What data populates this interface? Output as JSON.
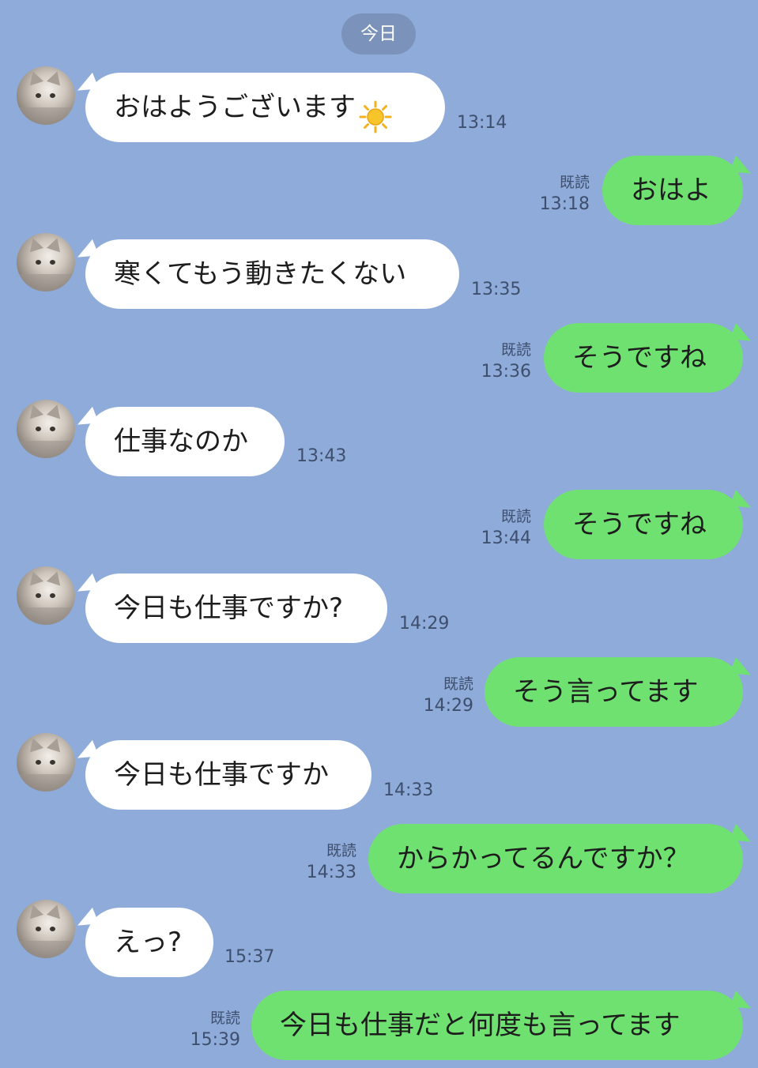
{
  "date_label": "今日",
  "read_label": "既読",
  "colors": {
    "background": "#8fabd9",
    "incoming_bubble": "#ffffff",
    "outgoing_bubble": "#6fe170",
    "date_pill": "#7b93bb"
  },
  "messages": [
    {
      "side": "in",
      "text": "おはようございます",
      "emoji": "sun-icon",
      "time": "13:14"
    },
    {
      "side": "out",
      "text": "おはよ",
      "read": "既読",
      "time": "13:18"
    },
    {
      "side": "in",
      "text": "寒くてもう動きたくない",
      "time": "13:35"
    },
    {
      "side": "out",
      "text": "そうですね",
      "read": "既読",
      "time": "13:36"
    },
    {
      "side": "in",
      "text": "仕事なのか",
      "time": "13:43"
    },
    {
      "side": "out",
      "text": "そうですね",
      "read": "既読",
      "time": "13:44"
    },
    {
      "side": "in",
      "text": "今日も仕事ですか?",
      "time": "14:29"
    },
    {
      "side": "out",
      "text": "そう言ってます",
      "read": "既読",
      "time": "14:29"
    },
    {
      "side": "in",
      "text": "今日も仕事ですか",
      "time": "14:33"
    },
    {
      "side": "out",
      "text": "からかってるんですか？",
      "read": "既読",
      "time": "14:33"
    },
    {
      "side": "in",
      "text": "えっ?",
      "time": "15:37"
    },
    {
      "side": "out",
      "text": "今日も仕事だと何度も言ってます",
      "read": "既読",
      "time": "15:39"
    }
  ]
}
